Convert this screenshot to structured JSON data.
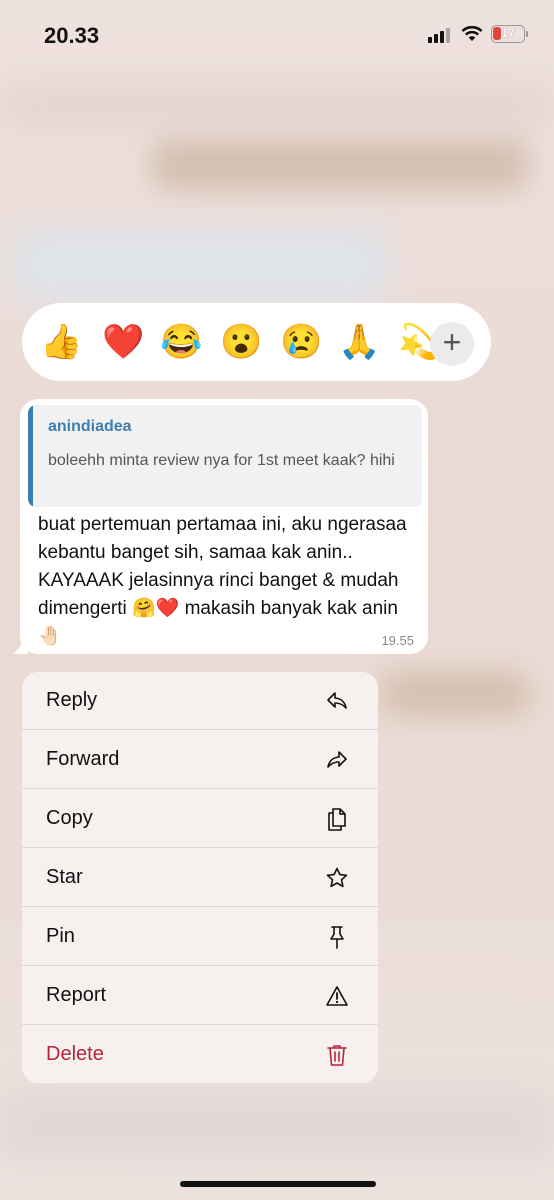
{
  "status_bar": {
    "time": "20.33",
    "battery": "17"
  },
  "reactions": {
    "emojis": [
      "👍",
      "❤️",
      "😂",
      "😮",
      "😢",
      "🙏",
      "💫"
    ],
    "more_label": "+"
  },
  "message": {
    "reply_to": {
      "author": "anindiadea",
      "text": "boleehh minta review nya for 1st meet kaak? hihi"
    },
    "text": "buat pertemuan pertamaa ini, aku ngerasaa kebantu banget sih, samaa kak anin.. KAYAAAK jelasinnya rinci banget & mudah dimengerti 🤗❤️ makasih banyak kak anin 🤚🏻",
    "time": "19.55"
  },
  "menu": {
    "items": [
      {
        "label": "Reply",
        "icon": "reply-icon"
      },
      {
        "label": "Forward",
        "icon": "forward-icon"
      },
      {
        "label": "Copy",
        "icon": "copy-icon"
      },
      {
        "label": "Star",
        "icon": "star-icon"
      },
      {
        "label": "Pin",
        "icon": "pin-icon"
      },
      {
        "label": "Report",
        "icon": "warning-icon"
      },
      {
        "label": "Delete",
        "icon": "trash-icon",
        "danger": true
      }
    ]
  },
  "colors": {
    "accent": "#3d7fb0",
    "danger": "#b3263a"
  }
}
